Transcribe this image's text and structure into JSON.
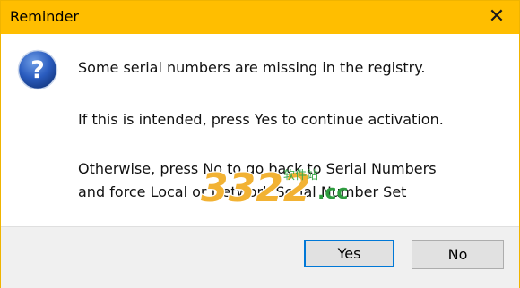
{
  "window": {
    "title": "Reminder",
    "close_icon": "close-icon"
  },
  "message": {
    "line1": "Some serial numbers are missing in the registry.",
    "line2": "If this is intended, press Yes to continue activation.",
    "line3": "Otherwise, press No to go back to Serial Numbers",
    "line4": "and force Local or Network Serial Number Set"
  },
  "buttons": {
    "yes": "Yes",
    "no": "No"
  },
  "watermark": {
    "main": "3322",
    "tag": "软件站",
    "suffix": ".cc"
  },
  "colors": {
    "titlebar": "#ffbe00",
    "accent": "#0078d7",
    "icon_blue": "#1f4fa8"
  }
}
